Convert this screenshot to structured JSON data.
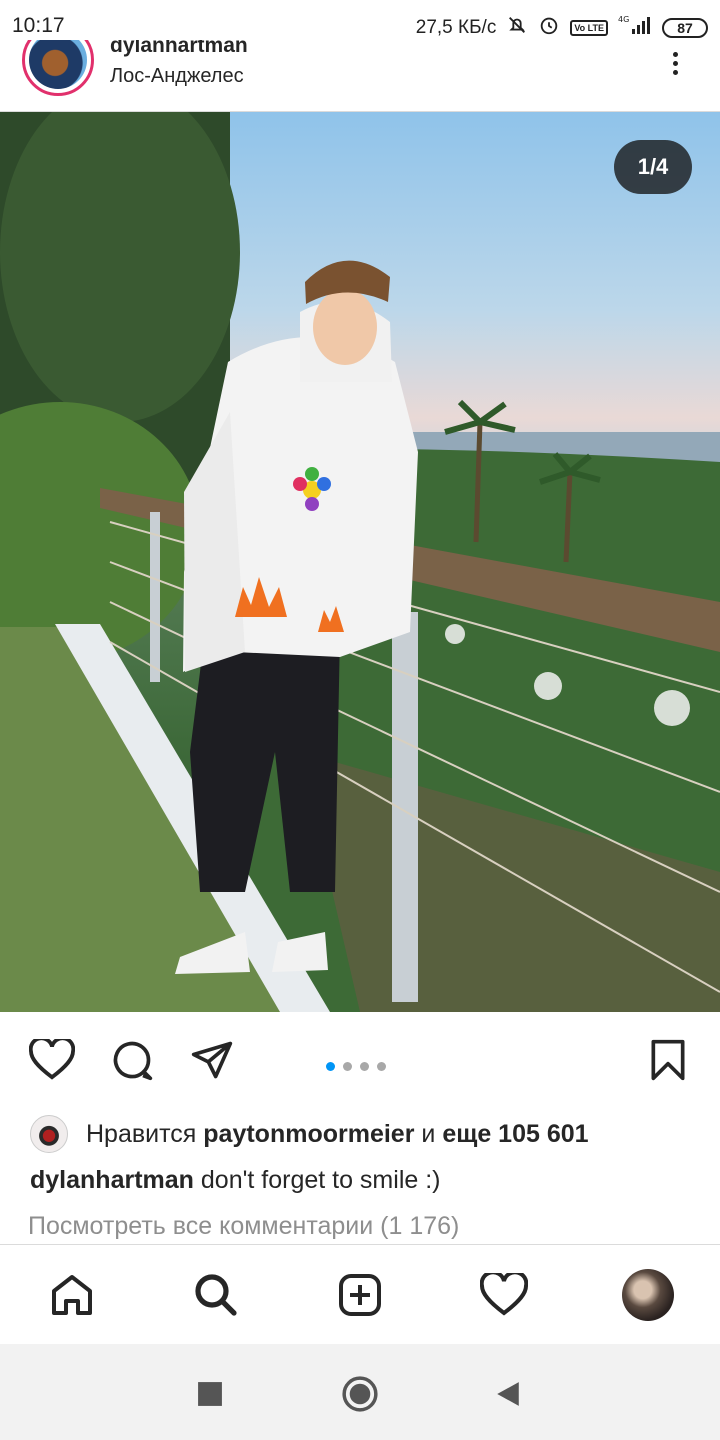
{
  "status_bar": {
    "time": "10:17",
    "speed": "27,5 КБ/с",
    "network": "4G",
    "lte": "Vo LTE",
    "battery": "87"
  },
  "post": {
    "username": "dylanhartman",
    "location": "Лос-Анджелес",
    "photo_counter": "1/4",
    "carousel": {
      "count": 4,
      "active_index": 0
    },
    "liked_by_prefix": "Нравится",
    "liked_by_user": "paytonmoormeier",
    "liked_by_and": "и",
    "liked_by_more": "еще 105 601",
    "caption_user": "dylanhartman",
    "caption_text": "don't forget to smile :)",
    "view_comments": "Посмотреть все комментарии (1 176)"
  },
  "icons": {
    "like": "heart-icon",
    "comment": "comment-icon",
    "share": "send-icon",
    "save": "bookmark-icon",
    "more": "more-vertical-icon"
  },
  "bottom_nav": [
    "home-icon",
    "search-icon",
    "add-post-icon",
    "activity-heart-icon",
    "profile-avatar"
  ],
  "colors": {
    "accent": "#0095f6",
    "text": "#262626",
    "muted": "#8e8e8e"
  }
}
